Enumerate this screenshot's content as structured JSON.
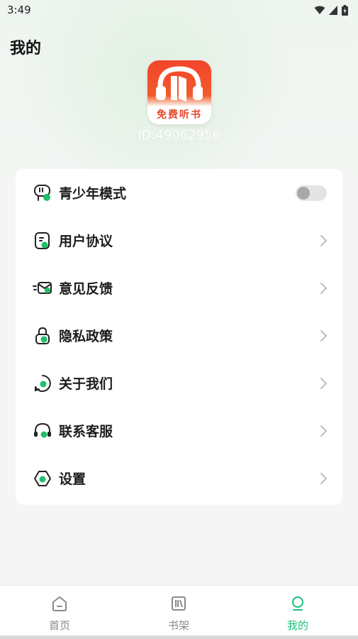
{
  "status_bar": {
    "time": "3:49"
  },
  "page": {
    "title": "我的"
  },
  "logo": {
    "text": "免费听书"
  },
  "user": {
    "id_label": "ID:49062956"
  },
  "menu": {
    "teen_mode": {
      "label": "青少年模式",
      "enabled": false
    },
    "items": [
      {
        "label": "用户协议",
        "icon": "document-icon"
      },
      {
        "label": "意见反馈",
        "icon": "envelope-icon"
      },
      {
        "label": "隐私政策",
        "icon": "lock-icon"
      },
      {
        "label": "关于我们",
        "icon": "info-circle-icon"
      },
      {
        "label": "联系客服",
        "icon": "headset-icon"
      },
      {
        "label": "设置",
        "icon": "settings-icon"
      }
    ]
  },
  "tabs": [
    {
      "label": "首页",
      "icon": "home-icon",
      "active": false
    },
    {
      "label": "书架",
      "icon": "bookshelf-icon",
      "active": false
    },
    {
      "label": "我的",
      "icon": "profile-icon",
      "active": true
    }
  ],
  "colors": {
    "accent": "#17c37a",
    "brand_red": "#f2452b",
    "icon_dot": "#1fbf6b"
  }
}
